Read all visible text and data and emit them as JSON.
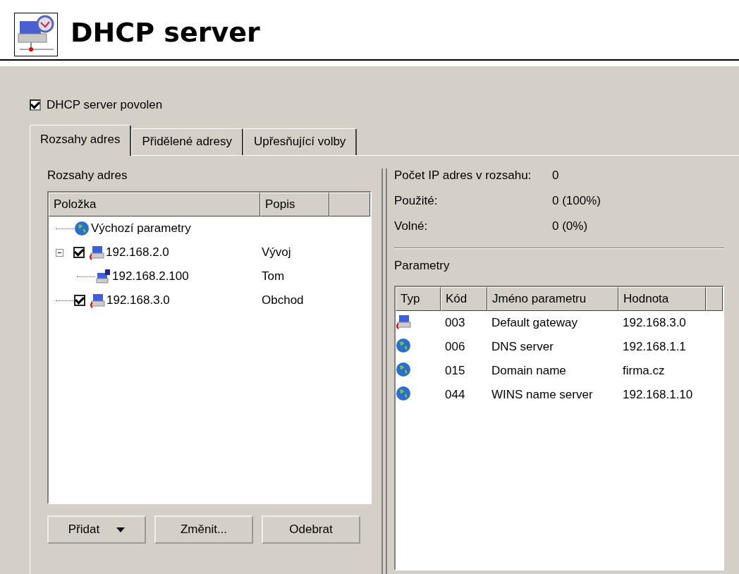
{
  "header": {
    "title": "DHCP server"
  },
  "enable": {
    "label": "DHCP server povolen",
    "checked": true
  },
  "tabs": [
    {
      "label": "Rozsahy adres",
      "selected": true
    },
    {
      "label": "Přidělené adresy",
      "selected": false
    },
    {
      "label": "Upřesňující volby",
      "selected": false
    }
  ],
  "scopes": {
    "title": "Rozsahy adres",
    "columns": [
      "Položka",
      "Popis"
    ],
    "items": [
      {
        "kind": "globe",
        "name": "Výchozí parametry"
      },
      {
        "kind": "scope",
        "name": "192.168.2.0",
        "description": "Vývoj",
        "checked": true,
        "expanded": true,
        "children": [
          {
            "kind": "reservation",
            "name": "192.168.2.100",
            "description": "Tom"
          }
        ]
      },
      {
        "kind": "scope",
        "name": "192.168.3.0",
        "description": "Obchod",
        "checked": true
      }
    ],
    "buttons": [
      {
        "label": "Přidat",
        "dropdown": true
      },
      {
        "label": "Změnit...",
        "dropdown": false
      },
      {
        "label": "Odebrat",
        "dropdown": false
      }
    ]
  },
  "stats": [
    {
      "label": "Počet IP adres v rozsahu:",
      "value": "0"
    },
    {
      "label": "Použité:",
      "value": "0  (100%)"
    },
    {
      "label": "Volné:",
      "value": "0  (0%)"
    }
  ],
  "parameters": {
    "title": "Parametry",
    "columns": [
      "Typ",
      "Kód",
      "Jméno parametru",
      "Hodnota"
    ],
    "rows": [
      {
        "kind": "scope",
        "code": "003",
        "name": "Default gateway",
        "value": "192.168.3.0"
      },
      {
        "kind": "globe",
        "code": "006",
        "name": "DNS server",
        "value": "192.168.1.1"
      },
      {
        "kind": "globe",
        "code": "015",
        "name": "Domain name",
        "value": "firma.cz"
      },
      {
        "kind": "globe",
        "code": "044",
        "name": "WINS name server",
        "value": "192.168.1.10"
      }
    ]
  }
}
